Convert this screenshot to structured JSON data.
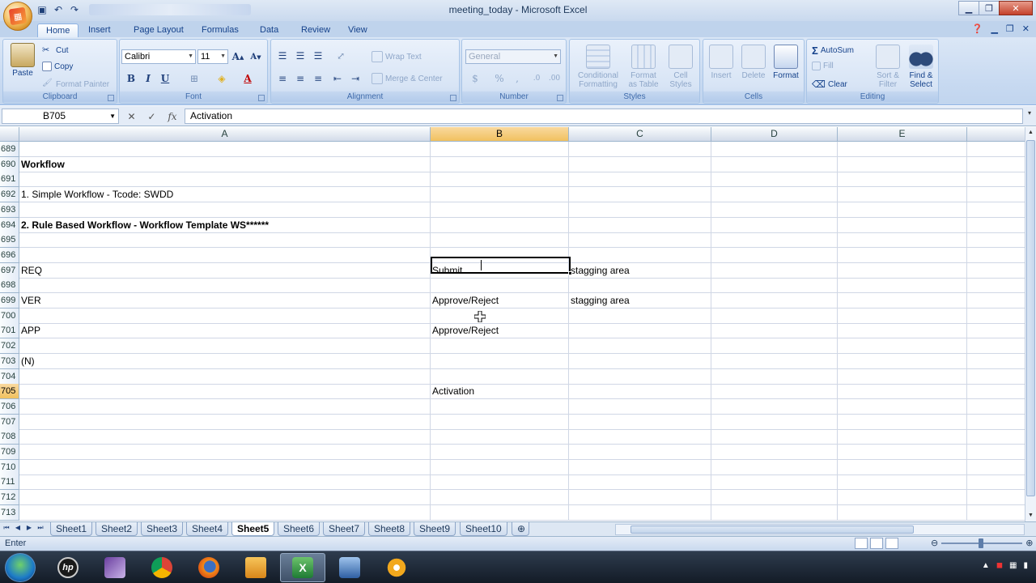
{
  "window": {
    "title": "meeting_today - Microsoft Excel",
    "controls": [
      "minimize",
      "maximize",
      "close"
    ]
  },
  "tabs": [
    {
      "label": "Home",
      "active": true
    },
    {
      "label": "Insert"
    },
    {
      "label": "Page Layout"
    },
    {
      "label": "Formulas"
    },
    {
      "label": "Data"
    },
    {
      "label": "Review"
    },
    {
      "label": "View"
    }
  ],
  "ribbon": {
    "clipboard": {
      "label": "Clipboard",
      "paste": "Paste",
      "cut": "Cut",
      "copy": "Copy",
      "format_painter": "Format Painter"
    },
    "font": {
      "label": "Font",
      "name": "Calibri",
      "size": "11",
      "bold": "B",
      "italic": "I",
      "underline": "U"
    },
    "alignment": {
      "label": "Alignment",
      "wrap": "Wrap Text",
      "merge": "Merge & Center"
    },
    "number": {
      "label": "Number",
      "format": "General"
    },
    "styles": {
      "label": "Styles",
      "conditional": [
        "Conditional",
        "Formatting"
      ],
      "as_table": [
        "Format",
        "as Table"
      ],
      "cell_styles": [
        "Cell",
        "Styles"
      ]
    },
    "cells": {
      "label": "Cells",
      "insert": "Insert",
      "delete": "Delete",
      "format": "Format"
    },
    "editing": {
      "label": "Editing",
      "autosum": "AutoSum",
      "fill": "Fill",
      "clear": "Clear",
      "sort": [
        "Sort &",
        "Filter"
      ],
      "find": [
        "Find &",
        "Select"
      ]
    }
  },
  "formula_bar": {
    "name_box": "B705",
    "fx": "fx",
    "content": "Activation"
  },
  "columns": [
    {
      "label": "A",
      "selected": false
    },
    {
      "label": "B",
      "selected": true
    },
    {
      "label": "C",
      "selected": false
    },
    {
      "label": "D",
      "selected": false
    },
    {
      "label": "E",
      "selected": false
    }
  ],
  "rows": [
    {
      "num": "689",
      "a": "",
      "b": "",
      "c": ""
    },
    {
      "num": "690",
      "a": "Workflow",
      "b": "",
      "c": "",
      "bold": true
    },
    {
      "num": "691",
      "a": "",
      "b": "",
      "c": ""
    },
    {
      "num": "692",
      "a": "1. Simple Workflow - Tcode: SWDD",
      "b": "",
      "c": ""
    },
    {
      "num": "693",
      "a": "",
      "b": "",
      "c": ""
    },
    {
      "num": "694",
      "a": "2. Rule Based Workflow - Workflow Template WS******",
      "b": "",
      "c": "",
      "bold": true
    },
    {
      "num": "695",
      "a": "",
      "b": "",
      "c": ""
    },
    {
      "num": "696",
      "a": "",
      "b": "",
      "c": ""
    },
    {
      "num": "697",
      "a": "REQ",
      "b": "Submit",
      "c": "stagging area"
    },
    {
      "num": "698",
      "a": "",
      "b": "",
      "c": ""
    },
    {
      "num": "699",
      "a": "VER",
      "b": "Approve/Reject",
      "c": "stagging area"
    },
    {
      "num": "700",
      "a": "",
      "b": "",
      "c": ""
    },
    {
      "num": "701",
      "a": "APP",
      "b": "Approve/Reject",
      "c": ""
    },
    {
      "num": "702",
      "a": "",
      "b": "",
      "c": ""
    },
    {
      "num": "703",
      "a": "(N)",
      "b": "",
      "c": ""
    },
    {
      "num": "704",
      "a": "",
      "b": "",
      "c": ""
    },
    {
      "num": "705",
      "a": "",
      "b": "Activation",
      "c": "",
      "selected": true
    },
    {
      "num": "706",
      "a": "",
      "b": "",
      "c": ""
    },
    {
      "num": "707",
      "a": "",
      "b": "",
      "c": ""
    },
    {
      "num": "708",
      "a": "",
      "b": "",
      "c": ""
    },
    {
      "num": "709",
      "a": "",
      "b": "",
      "c": ""
    },
    {
      "num": "710",
      "a": "",
      "b": "",
      "c": ""
    },
    {
      "num": "711",
      "a": "",
      "b": "",
      "c": ""
    },
    {
      "num": "712",
      "a": "",
      "b": "",
      "c": ""
    },
    {
      "num": "713",
      "a": "",
      "b": "",
      "c": ""
    }
  ],
  "sheets": [
    "Sheet1",
    "Sheet2",
    "Sheet3",
    "Sheet4",
    "Sheet5",
    "Sheet6",
    "Sheet7",
    "Sheet8",
    "Sheet9",
    "Sheet10"
  ],
  "active_sheet": "Sheet5",
  "status": {
    "mode": "Enter"
  },
  "taskbar": {
    "items": [
      "hp-icon",
      "visual-studio-icon",
      "chrome-icon",
      "firefox-icon",
      "media-player-icon",
      "excel-icon",
      "remote-desktop-icon",
      "sap-icon"
    ],
    "active": "excel-icon"
  },
  "colors": {
    "accent": "#15428b",
    "selection_header": "#f1c15f",
    "grid": "#d0d7e5"
  }
}
